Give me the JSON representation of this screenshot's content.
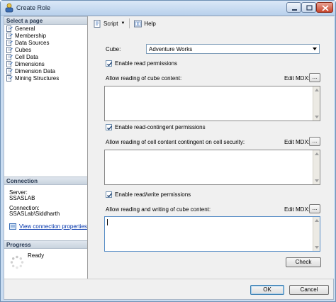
{
  "window": {
    "title": "Create Role"
  },
  "left_pane": {
    "select_page_header": "Select a page",
    "pages": [
      {
        "label": "General",
        "icon": "page-icon"
      },
      {
        "label": "Membership",
        "icon": "page-icon"
      },
      {
        "label": "Data Sources",
        "icon": "page-icon"
      },
      {
        "label": "Cubes",
        "icon": "page-icon"
      },
      {
        "label": "Cell Data",
        "icon": "page-icon"
      },
      {
        "label": "Dimensions",
        "icon": "page-icon"
      },
      {
        "label": "Dimension Data",
        "icon": "page-icon"
      },
      {
        "label": "Mining Structures",
        "icon": "page-icon"
      }
    ],
    "connection_header": "Connection",
    "server_label": "Server:",
    "server_value": "SSASLAB",
    "connection_label": "Connection:",
    "connection_value": "SSASLab\\Siddharth",
    "view_connection_link": "View connection properties",
    "progress_header": "Progress",
    "progress_status": "Ready"
  },
  "toolbar": {
    "script_label": "Script",
    "help_label": "Help"
  },
  "form": {
    "cube_label": "Cube:",
    "cube_value": "Adventure Works",
    "read_checkbox_label": "Enable read permissions",
    "read_checked": true,
    "read_area_label": "Allow reading of cube content:",
    "read_area_value": "",
    "edit_mdx_label": "Edit MDX:",
    "ellipsis": "...",
    "contingent_checkbox_label": "Enable read-contingent permissions",
    "contingent_checked": true,
    "contingent_area_label": "Allow reading of cell content contingent on cell security:",
    "contingent_area_value": "",
    "readwrite_checkbox_label": "Enable read/write permissions",
    "readwrite_checked": true,
    "readwrite_area_label": "Allow reading and writing of cube content:",
    "readwrite_area_value": "",
    "check_button": "Check"
  },
  "footer": {
    "ok_button": "OK",
    "cancel_button": "Cancel"
  }
}
